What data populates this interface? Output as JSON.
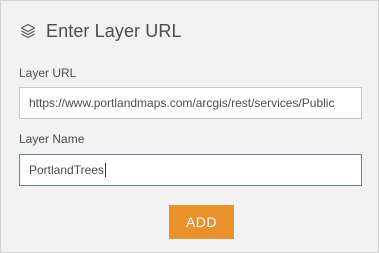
{
  "dialog": {
    "title": "Enter Layer URL",
    "header_icon": "layers-icon"
  },
  "layer_url": {
    "label": "Layer URL",
    "value": "https://www.portlandmaps.com/arcgis/rest/services/Public"
  },
  "layer_name": {
    "label": "Layer Name",
    "value": "PortlandTrees"
  },
  "actions": {
    "add_label": "ADD"
  },
  "colors": {
    "accent": "#e8912d",
    "focus_border": "#5e84a8",
    "panel_bg": "#f2f2f2",
    "text": "#4c4c4c"
  }
}
